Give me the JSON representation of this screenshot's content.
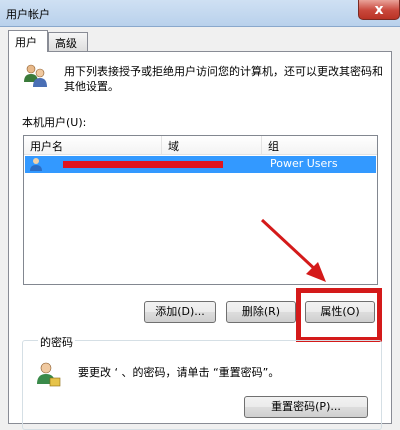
{
  "window": {
    "title": "用户帐户",
    "close_glyph": "x"
  },
  "tabs": [
    {
      "label": "用户"
    },
    {
      "label": "高级"
    }
  ],
  "description": "用下列表接授予或拒绝用户访问您的计算机，还可以更改其密码和其他设置。",
  "local_users_label": "本机用户(U):",
  "user_list": {
    "columns": [
      "用户名",
      "域",
      "组"
    ],
    "rows": [
      {
        "name": "",
        "domain": "",
        "group": "Power Users"
      }
    ]
  },
  "buttons": {
    "add": "添加(D)...",
    "remove": "删除(R)",
    "properties": "属性(O)"
  },
  "password_section": {
    "legend": "的密码",
    "text": "要更改 ‘ 、的密码，请单击 “重置密码”。",
    "reset_button": "重置密码(P)..."
  },
  "annotation": {
    "color": "#d41a1a"
  }
}
